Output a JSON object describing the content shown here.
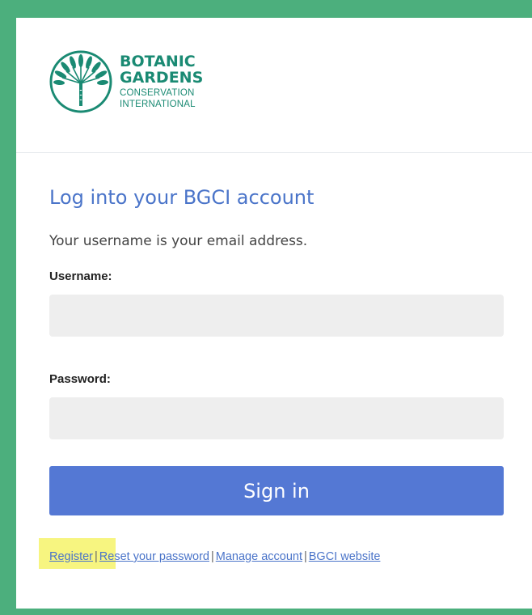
{
  "brand": {
    "line1": "BOTANIC",
    "line2": "GARDENS",
    "line3": "CONSERVATION",
    "line4": "INTERNATIONAL",
    "color": "#1a8a73",
    "logo_icon": "palm-tree-emblem-icon"
  },
  "form": {
    "title": "Log into your BGCI account",
    "subtitle": "Your username is your email address.",
    "username_label": "Username:",
    "username_value": "",
    "password_label": "Password:",
    "password_value": "",
    "signin_label": "Sign in"
  },
  "links": {
    "register": "Register",
    "reset": "Reset your password",
    "manage": "Manage account",
    "website": "BGCI website",
    "separator": "|"
  },
  "colors": {
    "frame": "#4caf7d",
    "accent": "#5478d4",
    "title": "#4a74c9",
    "field_bg": "#eeeeee",
    "highlight": "#f6f36a"
  }
}
